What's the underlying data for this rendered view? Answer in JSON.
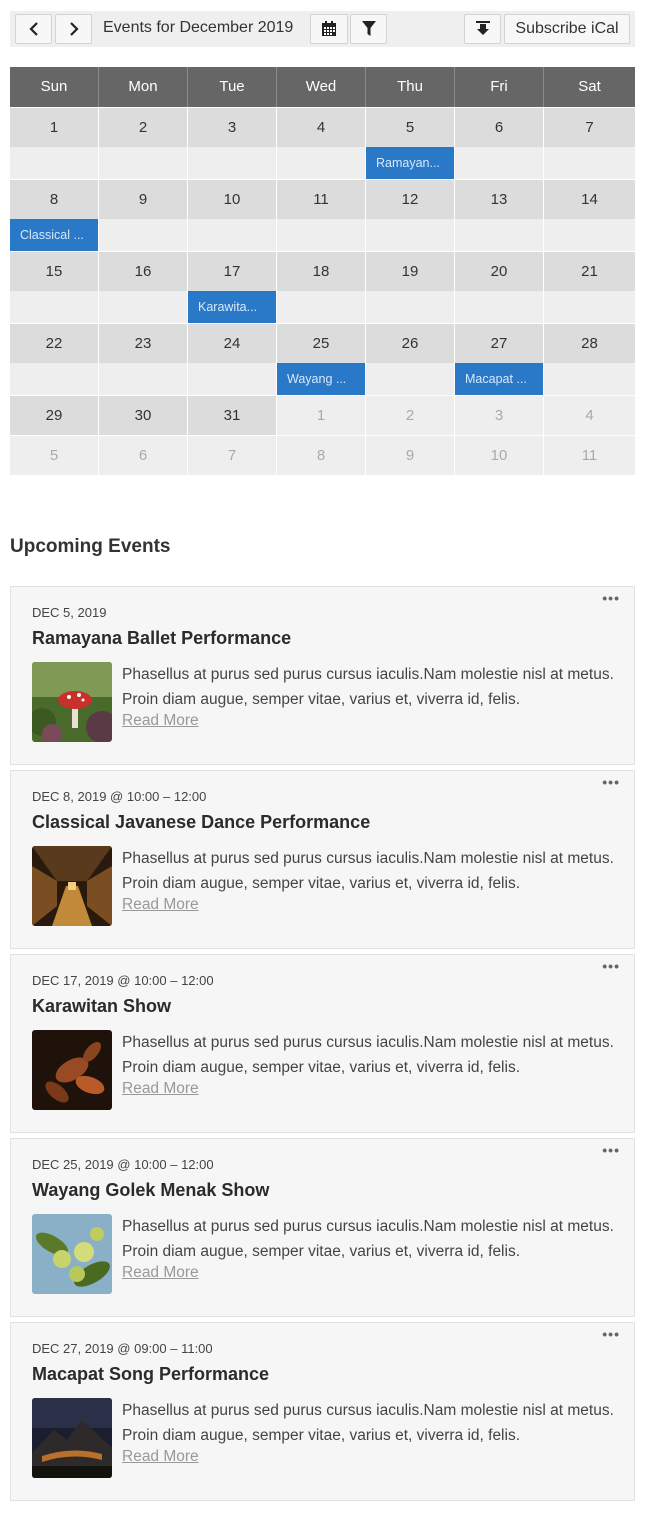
{
  "toolbar": {
    "title": "Events for December 2019",
    "subscribe_label": "Subscribe iCal"
  },
  "calendar": {
    "weekdays": [
      "Sun",
      "Mon",
      "Tue",
      "Wed",
      "Thu",
      "Fri",
      "Sat"
    ],
    "weeks": [
      {
        "days": [
          "1",
          "2",
          "3",
          "4",
          "5",
          "6",
          "7"
        ],
        "other": [
          false,
          false,
          false,
          false,
          false,
          false,
          false
        ],
        "events": [
          "",
          "",
          "",
          "",
          "Ramayan...",
          "",
          ""
        ]
      },
      {
        "days": [
          "8",
          "9",
          "10",
          "11",
          "12",
          "13",
          "14"
        ],
        "other": [
          false,
          false,
          false,
          false,
          false,
          false,
          false
        ],
        "events": [
          "Classical ...",
          "",
          "",
          "",
          "",
          "",
          ""
        ]
      },
      {
        "days": [
          "15",
          "16",
          "17",
          "18",
          "19",
          "20",
          "21"
        ],
        "other": [
          false,
          false,
          false,
          false,
          false,
          false,
          false
        ],
        "events": [
          "",
          "",
          "Karawita...",
          "",
          "",
          "",
          ""
        ]
      },
      {
        "days": [
          "22",
          "23",
          "24",
          "25",
          "26",
          "27",
          "28"
        ],
        "other": [
          false,
          false,
          false,
          false,
          false,
          false,
          false
        ],
        "events": [
          "",
          "",
          "",
          "Wayang ...",
          "",
          "Macapat ...",
          ""
        ]
      },
      {
        "days": [
          "29",
          "30",
          "31",
          "1",
          "2",
          "3",
          "4"
        ],
        "other": [
          false,
          false,
          false,
          true,
          true,
          true,
          true
        ],
        "last": [
          "5",
          "6",
          "7",
          "8",
          "9",
          "10",
          "11"
        ]
      }
    ]
  },
  "upcoming": {
    "heading": "Upcoming Events",
    "events": [
      {
        "date": "DEC 5, 2019",
        "title": "Ramayana Ballet Performance",
        "desc": "Phasellus at purus sed purus cursus iaculis.Nam molestie nisl at metus. Proin diam augue, semper vitae, varius et, viverra id, felis.",
        "more": "Read More",
        "dots": "•••",
        "thumb": "mushroom"
      },
      {
        "date": "DEC 8, 2019 @ 10:00 – 12:00",
        "title": "Classical Javanese Dance Performance",
        "desc": "Phasellus at purus sed purus cursus iaculis.Nam molestie nisl at metus. Proin diam augue, semper vitae, varius et, viverra id, felis.",
        "more": "Read More",
        "dots": "•••",
        "thumb": "bridge"
      },
      {
        "date": "DEC 17, 2019 @ 10:00 – 12:00",
        "title": "Karawitan Show",
        "desc": "Phasellus at purus sed purus cursus iaculis.Nam molestie nisl at metus. Proin diam augue, semper vitae, varius et, viverra id, felis.",
        "more": "Read More",
        "dots": "•••",
        "thumb": "leaves"
      },
      {
        "date": "DEC 25, 2019 @ 10:00 – 12:00",
        "title": "Wayang Golek Menak Show",
        "desc": "Phasellus at purus sed purus cursus iaculis.Nam molestie nisl at metus. Proin diam augue, semper vitae, varius et, viverra id, felis.",
        "more": "Read More",
        "dots": "•••",
        "thumb": "fruit"
      },
      {
        "date": "DEC 27, 2019 @ 09:00 – 11:00",
        "title": "Macapat Song Performance",
        "desc": "Phasellus at purus sed purus cursus iaculis.Nam molestie nisl at metus. Proin diam augue, semper vitae, varius et, viverra id, felis.",
        "more": "Read More",
        "dots": "•••",
        "thumb": "mountain"
      }
    ]
  },
  "colors": {
    "event_bg": "#2a78c8",
    "header_bg": "#666666",
    "day_bg": "#dcdcdc",
    "cell_bg": "#eeeeee"
  },
  "icons": [
    "chevron-left-icon",
    "chevron-right-icon",
    "calendar-icon",
    "filter-icon",
    "download-icon",
    "more-icon"
  ]
}
